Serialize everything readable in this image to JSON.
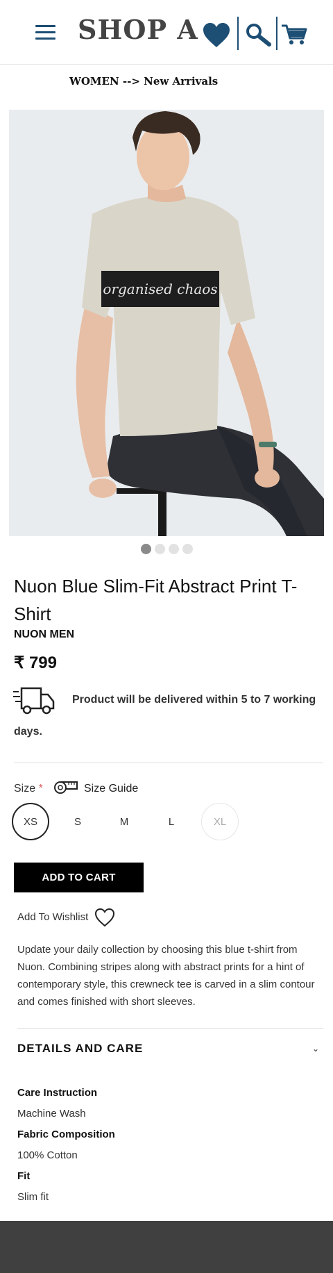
{
  "header": {
    "brand": "SHOP A",
    "icons": [
      "menu-icon",
      "heart-icon",
      "search-icon",
      "cart-icon"
    ],
    "accent_color": "#1d4e74"
  },
  "breadcrumb": "WOMEN --> New Arrivals",
  "gallery": {
    "image_count": 4,
    "active_index": 0,
    "print_text": "organised chaos"
  },
  "product": {
    "title": "Nuon Blue Slim-Fit Abstract Print T-Shirt",
    "brand": "NUON MEN",
    "price": "₹ 799",
    "delivery_line1": "Product will be delivered within 5 to 7 working",
    "delivery_line2": "days."
  },
  "size": {
    "label": "Size",
    "required_mark": "*",
    "guide_label": "Size Guide",
    "options": [
      "XS",
      "S",
      "M",
      "L",
      "XL"
    ],
    "selected": "XS",
    "unavailable": [
      "XL"
    ]
  },
  "actions": {
    "add_to_cart": "ADD TO CART",
    "add_to_wishlist": "Add To Wishlist"
  },
  "description": "Update your daily collection by choosing this blue t-shirt from Nuon. Combining stripes along with abstract prints for a hint of contemporary style, this crewneck tee is carved in a slim contour and comes finished with short sleeves.",
  "details": {
    "heading": "DETAILS AND CARE",
    "toggle_glyph": "⌄",
    "items": [
      {
        "label": "Care Instruction",
        "value": "Machine Wash"
      },
      {
        "label": "Fabric Composition",
        "value": "100% Cotton"
      },
      {
        "label": "Fit",
        "value": "Slim fit"
      }
    ]
  }
}
